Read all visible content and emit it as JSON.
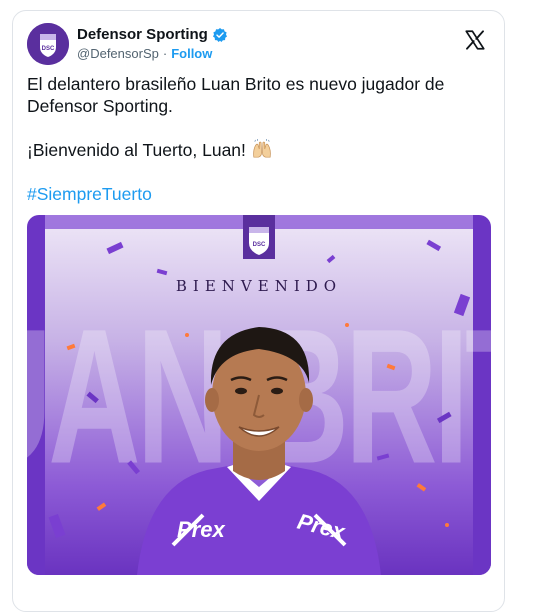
{
  "tweet": {
    "display_name": "Defensor Sporting",
    "handle": "@DefensorSp",
    "separator": "·",
    "follow_label": "Follow",
    "text_line1": "El delantero brasileño Luan Brito es nuevo jugador de Defensor Sporting.",
    "text_line2": "¡Bienvenido al Tuerto, Luan!",
    "hashtag": "#SiempreTuerto"
  },
  "media": {
    "headline": "BIENVENIDO",
    "big_name": "LUAN BRITO",
    "sponsor": "Prex",
    "crest_letters": "DSC"
  },
  "colors": {
    "brand_purple": "#5a2f9e",
    "link_blue": "#1d9bf0",
    "verified_blue": "#1d9bf0",
    "text_primary": "#0f1419",
    "text_secondary": "#536471"
  },
  "icons": {
    "verified": "verified-badge-icon",
    "x_logo": "x-logo-icon",
    "emoji": "raised-hands-emoji-icon"
  }
}
